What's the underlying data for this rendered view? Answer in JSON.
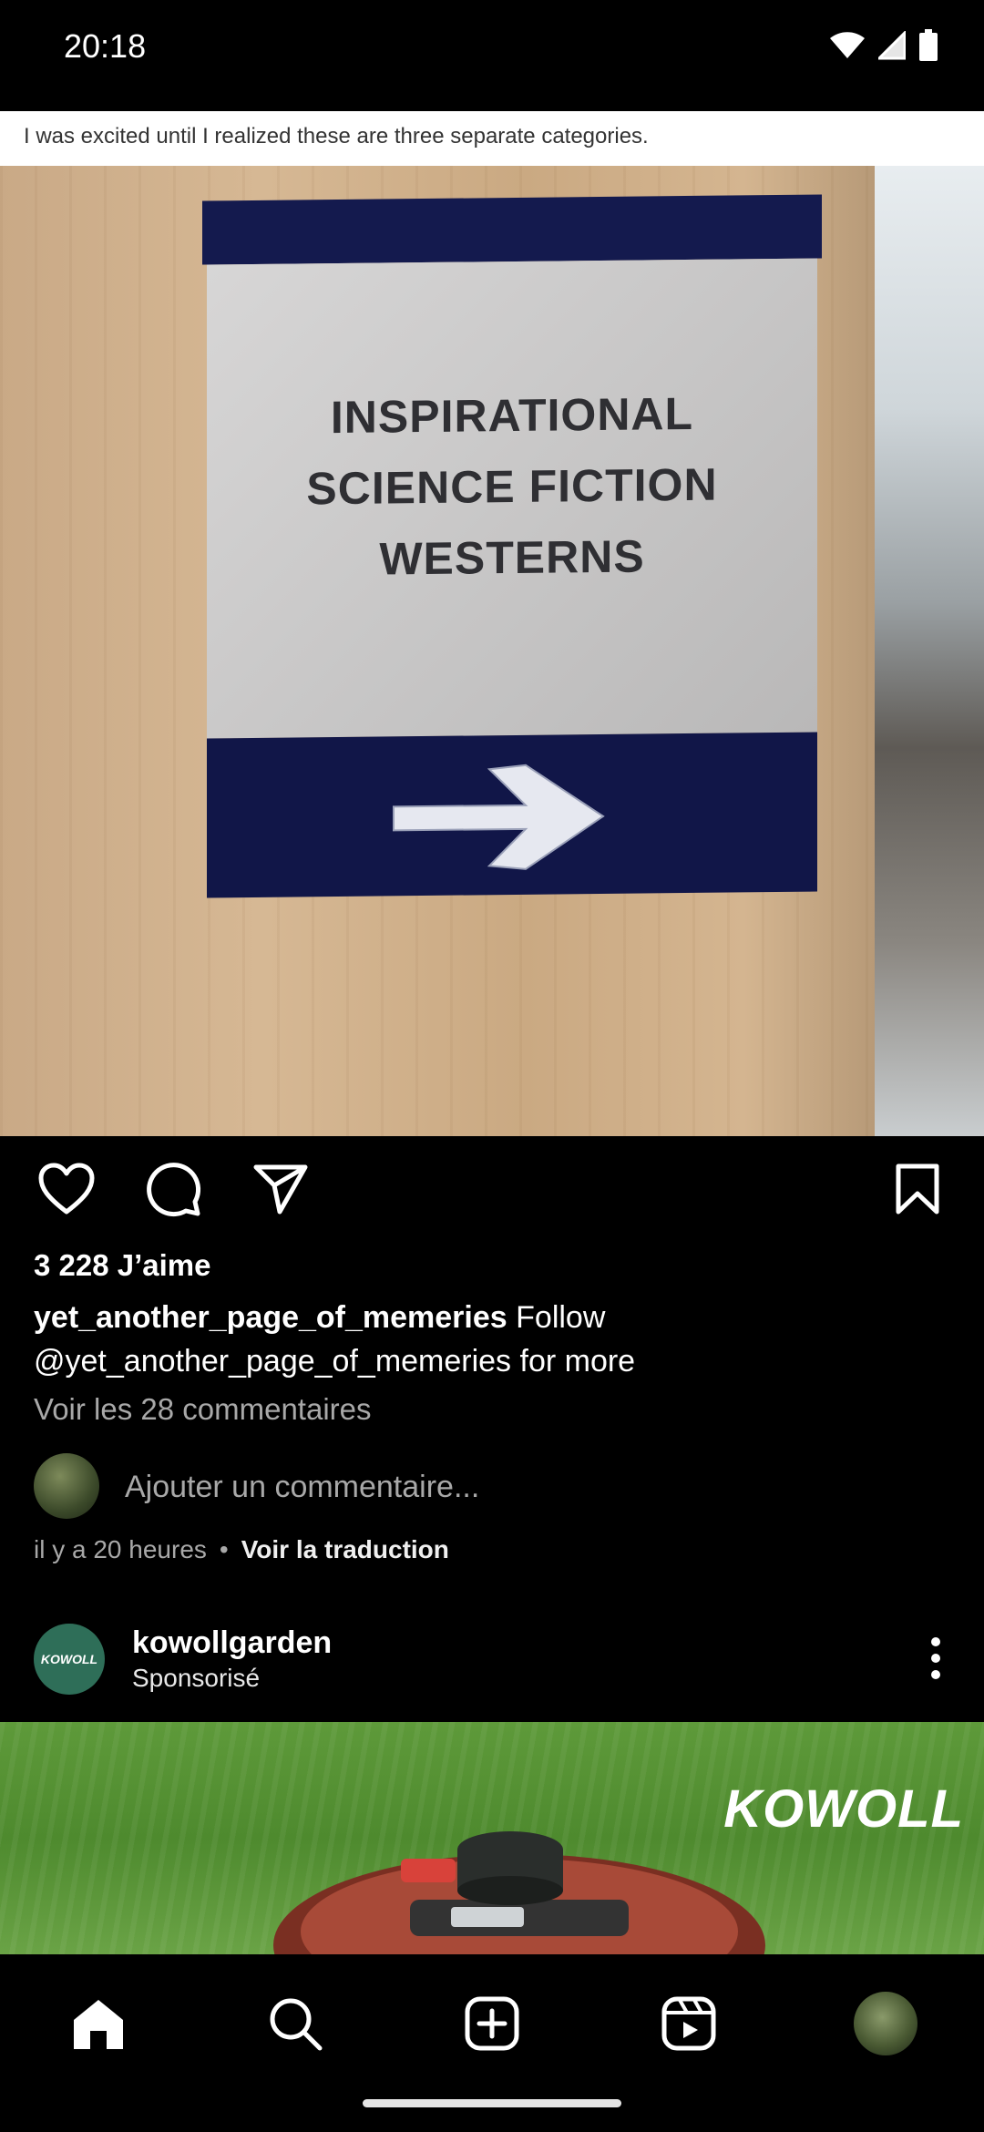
{
  "status_bar": {
    "time": "20:18"
  },
  "post": {
    "image_caption": "I was excited until I realized these are three separate categories.",
    "sign_lines": [
      "INSPIRATIONAL",
      "SCIENCE FICTION",
      "WESTERNS"
    ],
    "likes": "3 228 J’aime",
    "username": "yet_another_page_of_memeries",
    "caption": "Follow @yet_another_page_of_memeries for more",
    "view_comments": "Voir les 28 commentaires",
    "add_comment_placeholder": "Ajouter un commentaire...",
    "time_ago": "il y a 20 heures",
    "dot": "•",
    "translate": "Voir la traduction"
  },
  "ad": {
    "account": "kowollgarden",
    "sponsored": "Sponsorisé",
    "avatar_text": "KOWOLL",
    "logo": "KOWOLL"
  },
  "icons": {
    "like": "heart-icon",
    "comment": "comment-icon",
    "share": "send-icon",
    "save": "bookmark-icon",
    "more": "more-vertical-icon",
    "nav": [
      "home-icon",
      "search-icon",
      "create-icon",
      "reels-icon",
      "profile-avatar"
    ]
  },
  "colors": {
    "background": "#000000",
    "secondary_text": "#a8a8a8",
    "sign_navy": "#141a4e"
  }
}
